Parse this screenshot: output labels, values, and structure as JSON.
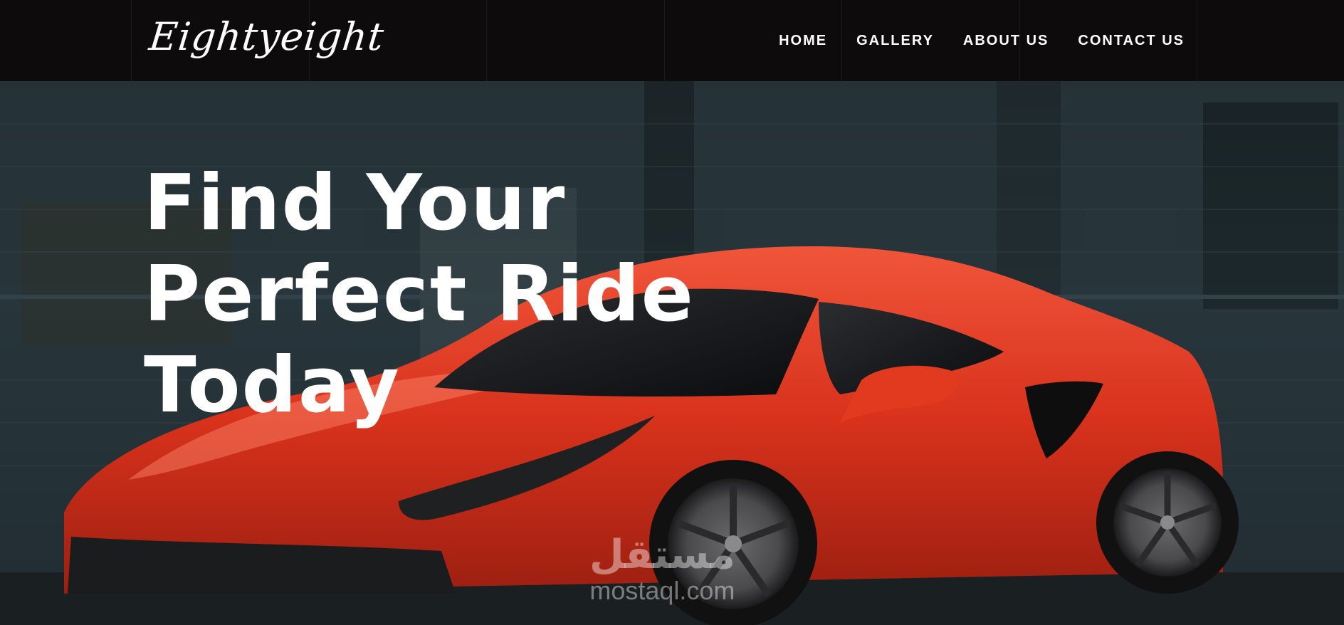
{
  "header": {
    "logo_text": "Eightyeight",
    "nav": [
      {
        "label": "HOME"
      },
      {
        "label": "GALLERY"
      },
      {
        "label": "ABOUT US"
      },
      {
        "label": "CONTACT US"
      }
    ]
  },
  "hero": {
    "headline_lines": [
      "Find Your",
      "Perfect Ride",
      "Today"
    ]
  },
  "watermark": {
    "arabic": "مستقل",
    "latin": "mostaql.com"
  },
  "colors": {
    "navbar": "#0e0b0c",
    "car_red": "#e23a1f",
    "wall": "#2a3a40",
    "text": "#ffffff"
  }
}
